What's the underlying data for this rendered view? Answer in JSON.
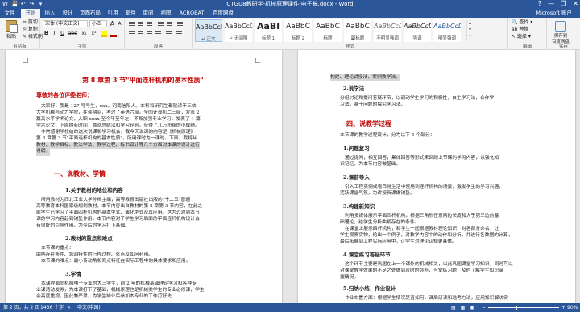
{
  "window": {
    "title": "CTGU8教研学-机械原理课件-电子稿.docx - Word",
    "help": "?",
    "minimize": "—",
    "restore": "❐",
    "close": "✕"
  },
  "quick_access": [
    "W",
    "💾",
    "↶",
    "↷",
    "▾"
  ],
  "tabs": [
    "文件",
    "开始",
    "插入",
    "设计",
    "页面布局",
    "引用",
    "邮件",
    "审阅",
    "视图",
    "ACROBAT",
    "百度网盘"
  ],
  "user": "Microsoft 账户",
  "ribbon": {
    "clipboard": {
      "paste": "粘贴",
      "cut": "✂ 剪切",
      "copy": "⎘ 复制",
      "painter": "✎ 格式刷",
      "label": "剪贴板"
    },
    "font": {
      "name": "宋体 (中文正文)",
      "size": "小四",
      "bold": "B",
      "italic": "I",
      "underline": "U",
      "strike": "abc",
      "sub": "x₂",
      "sup": "x²",
      "grow": "A",
      "shrink": "A",
      "label": "字体"
    },
    "paragraph": {
      "label": "段落"
    },
    "styles": [
      {
        "sample": "AaBbCcD",
        "name": "↵ 正文"
      },
      {
        "sample": "AaBbCcD",
        "name": "↵ 无间隔"
      },
      {
        "sample": "AaBl",
        "name": "标题 1"
      },
      {
        "sample": "AaBbC",
        "name": "标题 2"
      },
      {
        "sample": "AaBbC",
        "name": "标题"
      },
      {
        "sample": "AaBbC",
        "name": "副标题"
      },
      {
        "sample": "AaBbCcD",
        "name": "不明显强调"
      },
      {
        "sample": "AaBbCcD",
        "name": "强调"
      },
      {
        "sample": "AaBbCcD",
        "name": "明显强调"
      }
    ],
    "styles_label": "样式",
    "editing": {
      "find": "🔍 查找 ▾",
      "replace": "ab 替换",
      "select": "↖ 选择 ▾",
      "label": "编辑"
    },
    "save": {
      "label": "保存到\n百度网盘",
      "group": "保存"
    }
  },
  "left_page": {
    "chapter_title": "第 8 章第 3 节\"平面连杆机构的基本性质\"",
    "greeting": "尊敬的各位评委老师：",
    "intro": [
      "大家好，我是 127 号号生，xxx，河南信阳人。本科和研究生都就读于三峡",
      "大学机械与动力学院，在读期间，考过了英语六级，全国计算机二三级，发表 2",
      "篇高水平学术论文，入职 xxxx 至今年至年左，不断加强专业学习，发表了 1 篇",
      "学术论文，下周拥有时间，喜欢总结法和学习经验，获得了几万粉丝的小成绩。",
      "非常感谢学校给的这次说课和学习机会，我今天说课的内容是《机械原理》",
      "第 8 章第 3 节\"平面连杆机构的基本性质\"，所用课时为一课时，下面，我将从",
      "教材、教学目标、教法学法、教学过程、板书设计等几个方面对本课的设计进行",
      "说明。"
    ],
    "sec1": "一、说教材、学情",
    "sub1": "1.关于教材的地位和内容",
    "p1": [
      "所用教材为西北工业大学孙桓主编，高等教育出版社出版的\"十二五\"普通",
      "高等教育本科国家级规划教材，本节内容出自教材的第 8 章第 3 节内容，在此之",
      "前学生已学习了平面四杆机构的基本型式、演化型式及其应用。这为过渡到本节",
      "课的学习内容起到铺垫作用，本节内容对于学生学习后面的平面连杆机构设计会",
      "有很好的引导作用。为今后的学习打下基础。"
    ],
    "sub2": "2.教材的重点和难点",
    "p2": [
      "本节课的重点：",
      "曲柄存在条件、急回特性的行程过程、死点及如何利用。",
      "本节课的难点：最小传动角和死点特征在实际工程中的具体要求和应用。"
    ],
    "sub3": "3.学情",
    "p3": [
      "本课程面向机械电子专业的大三学生，前 2 年的机械基础理论学习和各种专",
      "业课活动发券，为本课打下了基础，机械原理也是机械类学生的专业必修课，学生",
      "会高度重视，因此兼严肃，为学生毕业后参加本专业的工作打好先..."
    ]
  },
  "right_page": {
    "top_line": "构建、理论讲授法、案例教学法。",
    "sub2": "2.说学法",
    "p_learn": [
      "分组讨论和提问答疑环节，以调动学生学习的积极性，自主学习法，合作学",
      "习法，基于问题的探究学习法。"
    ],
    "sec4": "四、说教学过程",
    "intro4": "本节课的教学过程设计，分为以下 5 个部分：",
    "s1": "1.问题复习",
    "p_s1": [
      "通过提问，相互回答，集体回答等形式来回顾上节课的学习内容，以强化知",
      "识记忆，为本节内容做基础。"
    ],
    "s2": "2.课前导入",
    "p_s2": [
      "引入工程实例或者日常生活中使用到连杆机构的场景，激发学生的学习兴趣，",
      "活跃课堂气氛，为讲授新课做铺垫。"
    ],
    "s3": "3.构建新知识",
    "p_s3": [
      "利用多媒体展示平面四杆机构，根据三角形任意两边长度和大于第三边的基",
      "础理论，给学生分析曲柄存在的条件。",
      "在课堂上展示四杆机构，和学生一起根据教材理论知识，对各部分命名，让",
      "学生观察实物，给出一个例子，对教学内容中的动作和分析，并进行各数据的计算，",
      "最后拓展到工程实际应用中，让学生对理论认知更具体。"
    ],
    "s4": "4.课堂练习答疑环节",
    "p_s4": [
      "这个环节主要是巩固在上一个课外的机械相关，以此巩固课堂学习知识，同时可以",
      "对课堂教学效果的不足之处做到及时的弥补，当堂练习题，及时了解学生知识掌",
      "握情况。"
    ],
    "s5": "5.归纳小结，作业设计",
    "p_s5": [
      "作业布置方面：根据学生情况是否如何，课后研读和选考方法，应用知识解决实",
      "际问题..."
    ]
  },
  "status": {
    "page": "第 2 页，共 2 页",
    "words": "1456 个字",
    "proof_icon": "✎",
    "lang": "中文(中国)",
    "view_icons": "▤ ▦ ▣",
    "zoom_minus": "−",
    "zoom_plus": "+",
    "zoom": "90%"
  },
  "colors": {
    "accent": "#2b579a",
    "heading_red": "#c00000",
    "highlight": "#d8d8d8"
  }
}
